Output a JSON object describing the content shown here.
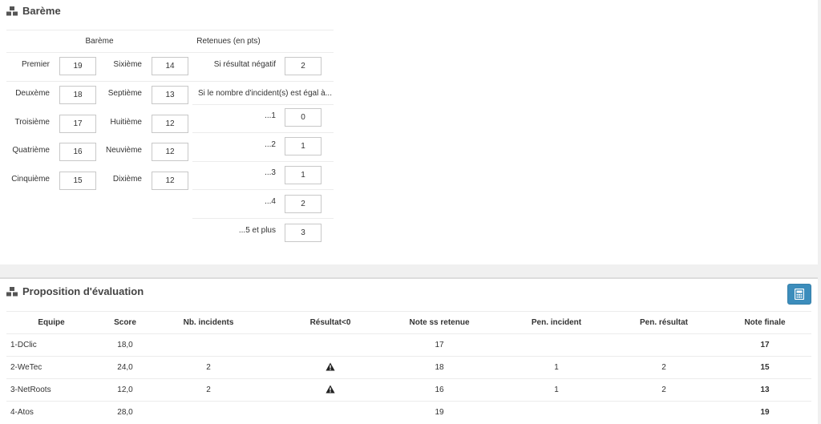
{
  "bareme": {
    "title": "Barème",
    "col_header_bareme": "Barème",
    "col_header_retenues": "Retenues (en pts)",
    "places": [
      {
        "label": "Premier",
        "value": "19"
      },
      {
        "label": "Deuxème",
        "value": "18"
      },
      {
        "label": "Troisième",
        "value": "17"
      },
      {
        "label": "Quatrième",
        "value": "16"
      },
      {
        "label": "Cinquième",
        "value": "15"
      },
      {
        "label": "Sixième",
        "value": "14"
      },
      {
        "label": "Septième",
        "value": "13"
      },
      {
        "label": "Huitième",
        "value": "12"
      },
      {
        "label": "Neuvième",
        "value": "12"
      },
      {
        "label": "Dixième",
        "value": "12"
      }
    ],
    "negative_label": "Si résultat négatif",
    "negative_value": "2",
    "incidents_intro": "Si le nombre d'incident(s) est égal à...",
    "incidents": [
      {
        "label": "...1",
        "value": "0"
      },
      {
        "label": "...2",
        "value": "1"
      },
      {
        "label": "...3",
        "value": "1"
      },
      {
        "label": "...4",
        "value": "2"
      },
      {
        "label": "...5 et plus",
        "value": "3"
      }
    ]
  },
  "evaluation": {
    "title": "Proposition d'évaluation",
    "columns": [
      "Equipe",
      "Score",
      "Nb. incidents",
      "Résultat<0",
      "Note ss retenue",
      "Pen. incident",
      "Pen. résultat",
      "Note finale"
    ],
    "rows": [
      {
        "team": "1-DClic",
        "score": "18,0",
        "incidents": "",
        "negative": false,
        "note_ss": "17",
        "pen_incident": "",
        "pen_resultat": "",
        "final": "17"
      },
      {
        "team": "2-WeTec",
        "score": "24,0",
        "incidents": "2",
        "negative": true,
        "note_ss": "18",
        "pen_incident": "1",
        "pen_resultat": "2",
        "final": "15"
      },
      {
        "team": "3-NetRoots",
        "score": "12,0",
        "incidents": "2",
        "negative": true,
        "note_ss": "16",
        "pen_incident": "1",
        "pen_resultat": "2",
        "final": "13"
      },
      {
        "team": "4-Atos",
        "score": "28,0",
        "incidents": "",
        "negative": false,
        "note_ss": "19",
        "pen_incident": "",
        "pen_resultat": "",
        "final": "19"
      }
    ]
  },
  "icons": {
    "section": "cubes-icon",
    "calculator": "calculator-icon",
    "warning": "warning-icon"
  },
  "colors": {
    "accent": "#3c8dbc"
  }
}
